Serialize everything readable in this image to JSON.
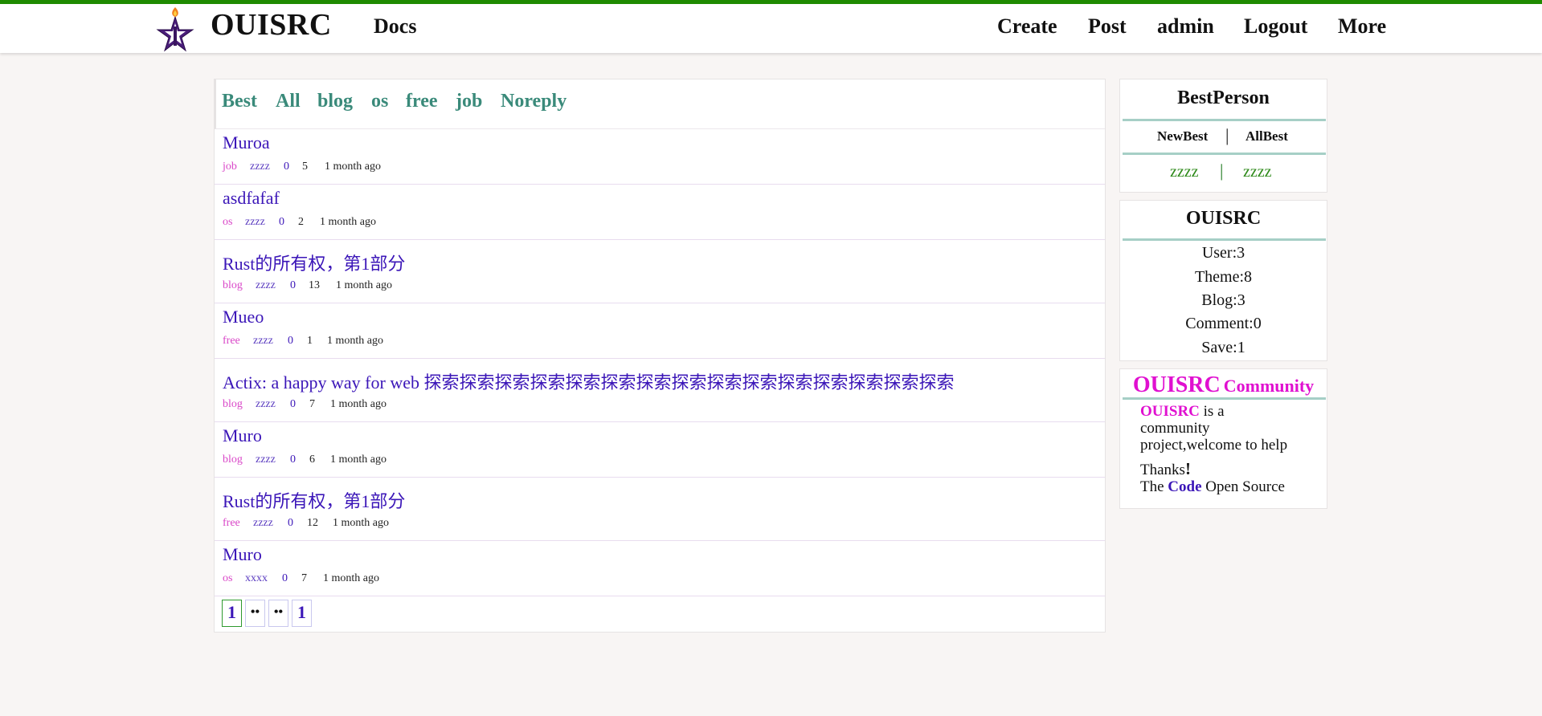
{
  "header": {
    "brand": "OUISRC",
    "docs": "Docs",
    "nav": [
      "Create",
      "Post",
      "admin",
      "Logout",
      "More"
    ]
  },
  "tabs": [
    "Best",
    "All",
    "blog",
    "os",
    "free",
    "job",
    "Noreply"
  ],
  "posts": [
    {
      "title": "Muroa",
      "category": "job",
      "user": "zzzz",
      "comments": "0",
      "views": "5",
      "time": "1 month ago"
    },
    {
      "title": "asdfafaf",
      "category": "os",
      "user": "zzzz",
      "comments": "0",
      "views": "2",
      "time": "1 month ago"
    },
    {
      "title": "Rust的所有权，第1部分",
      "category": "blog",
      "user": "zzzz",
      "comments": "0",
      "views": "13",
      "time": "1 month ago"
    },
    {
      "title": "Mueo",
      "category": "free",
      "user": "zzzz",
      "comments": "0",
      "views": "1",
      "time": "1 month ago"
    },
    {
      "title": "Actix: a happy way for web 探索探索探索探索探索探索探索探索探索探索探索探索探索探索探索",
      "category": "blog",
      "user": "zzzz",
      "comments": "0",
      "views": "7",
      "time": "1 month ago"
    },
    {
      "title": "Muro",
      "category": "blog",
      "user": "zzzz",
      "comments": "0",
      "views": "6",
      "time": "1 month ago"
    },
    {
      "title": "Rust的所有权，第1部分",
      "category": "free",
      "user": "zzzz",
      "comments": "0",
      "views": "12",
      "time": "1 month ago"
    },
    {
      "title": "Muro",
      "category": "os",
      "user": "xxxx",
      "comments": "0",
      "views": "7",
      "time": "1 month ago"
    }
  ],
  "pagination": [
    "1",
    "••",
    "••",
    "1"
  ],
  "best_person": {
    "title": "BestPerson",
    "new_best": "NewBest",
    "all_best": "AllBest",
    "separator": "|",
    "users": [
      "zzzz",
      "zzzz"
    ]
  },
  "stats": {
    "title": "OUISRC",
    "items": [
      "User:3",
      "Theme:8",
      "Blog:3",
      "Comment:0",
      "Save:1"
    ]
  },
  "community": {
    "title_brand": "OUISRC",
    "title_rest": "Community",
    "brand": "OUISRC",
    "line1_rest": " is a",
    "line2": "community",
    "line3": "project,welcome to help",
    "line4": "Thanks",
    "line4_mark": "!",
    "line5_pre": "The ",
    "line5_code": "Code",
    "line5_post": " Open Source"
  },
  "colors": {
    "header_accent": "#1f8a00",
    "tab_text": "#3a8a7a",
    "post_title": "#3b16b8",
    "category": "#d946c8",
    "community_pink": "#e010d0"
  }
}
